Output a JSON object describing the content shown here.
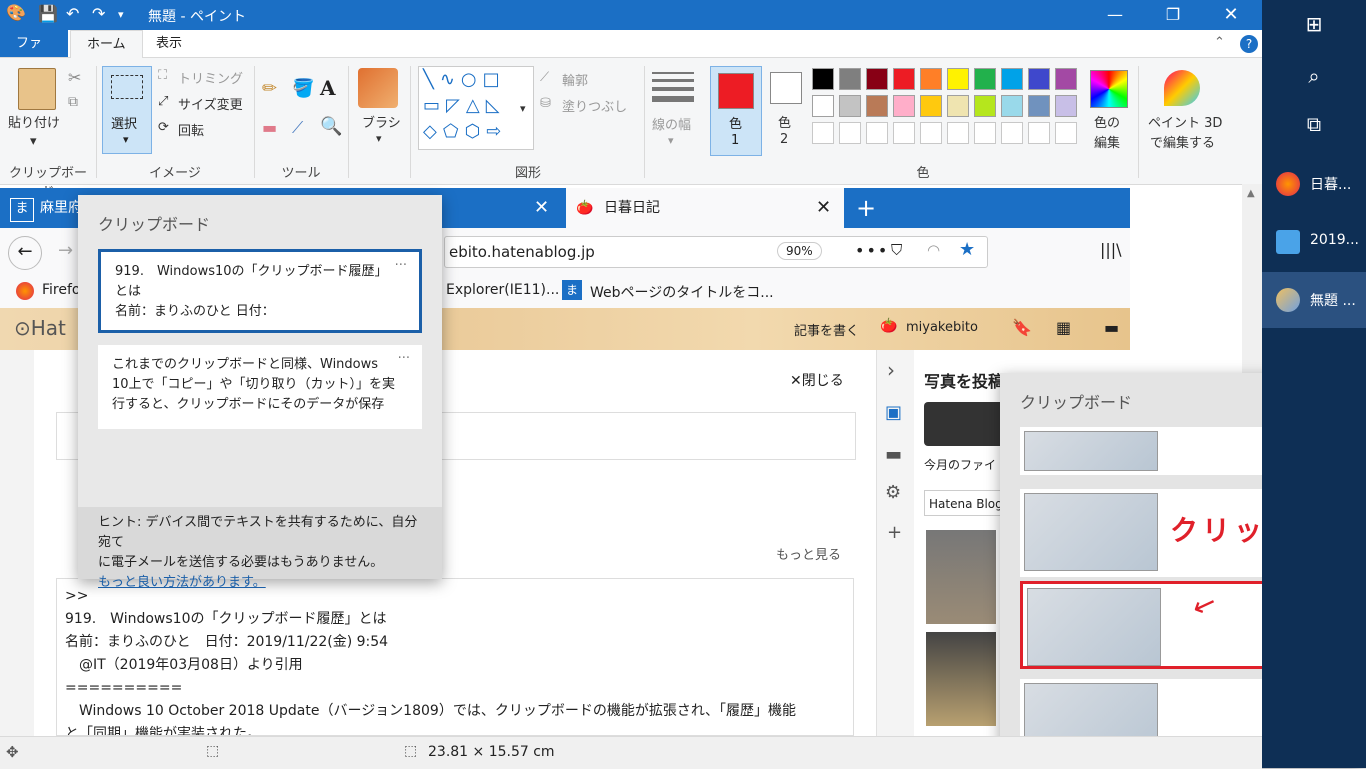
{
  "paint": {
    "title": "無題 - ペイント",
    "tabs": [
      "ファイル",
      "ホーム",
      "表示"
    ],
    "clipboard": {
      "paste": "貼り付け",
      "label": "クリップボード"
    },
    "image": {
      "select": "選択",
      "crop": "トリミング",
      "resize": "サイズ変更",
      "rotate": "回転",
      "label": "イメージ"
    },
    "tools": {
      "label": "ツール"
    },
    "brush": "ブラシ",
    "shapes": {
      "outline": "輪郭",
      "fill": "塗りつぶし",
      "label": "図形"
    },
    "size_label": "線の幅",
    "color1": "色\n1",
    "color1_a": "色",
    "color1_b": "1",
    "color2_a": "色",
    "color2_b": "2",
    "edit_colors_a": "色の",
    "edit_colors_b": "編集",
    "paint3d_a": "ペイント 3D",
    "paint3d_b": "で編集する",
    "colors_label": "色",
    "status_size": "23.81 × 15.57 cm",
    "color_primary": "#ed1c24",
    "palette_row1": [
      "#000000",
      "#7f7f7f",
      "#880015",
      "#ed1c24",
      "#ff7f27",
      "#fff200",
      "#22b14c",
      "#00a2e8",
      "#3f48cc",
      "#a349a4"
    ],
    "palette_row2": [
      "#ffffff",
      "#c3c3c3",
      "#b97a57",
      "#ffaec9",
      "#ffc90e",
      "#efe4b0",
      "#b5e61d",
      "#99d9ea",
      "#7092be",
      "#c8bfe7"
    ]
  },
  "browser": {
    "tab1": "麻里府",
    "tab_active": "日暮日記",
    "url": "ebito.hatenablog.jp",
    "zoom": "90%",
    "bookmarks": [
      "Firefo",
      "Explorer(IE11)...",
      "Webページのタイトルをコ..."
    ],
    "hatena_user": "miyakebito",
    "write_article": "記事を書く",
    "close_label": "閉じる",
    "more_label": "もっと見る",
    "photo_title": "写真を投稿",
    "today_files": "今月のファイ",
    "hatena_blog": "Hatena Blog",
    "editor_lines": [
      ">>",
      "919.　Windows10の「クリップボード履歴」とは",
      "名前：まりふのひと　日付：2019/11/22(金) 9:54",
      "　@IT（2019年03月08日）より引用",
      "==========",
      "　Windows 10 October 2018 Update（バージョン1809）では、クリップボードの機能が拡張され、「履歴」機能",
      "と「同期」機能が実装された。"
    ]
  },
  "clipboard_popup": {
    "title": "クリップボード",
    "item1_lines": [
      "919.　Windows10の「クリップボード履歴」",
      "とは",
      "名前：まりふのひと 日付："
    ],
    "item2_lines": [
      "これまでのクリップボードと同様、Windows",
      "10上で「コピー」や「切り取り（カット）」を実",
      "行すると、クリップボードにそのデータが保存"
    ],
    "hint": "ヒント: デバイス間でテキストを共有するために、自分宛て",
    "hint2": "に電子メールを送信する必要はもうありません。",
    "hint_link": "もっと良い方法があります。",
    "more": "···"
  },
  "clipboard_popup2": {
    "title": "クリップボード",
    "annotation": "クリック",
    "more": "···"
  },
  "taskbar": {
    "apps": [
      "日暮...",
      "2019...",
      "無題 ..."
    ]
  }
}
